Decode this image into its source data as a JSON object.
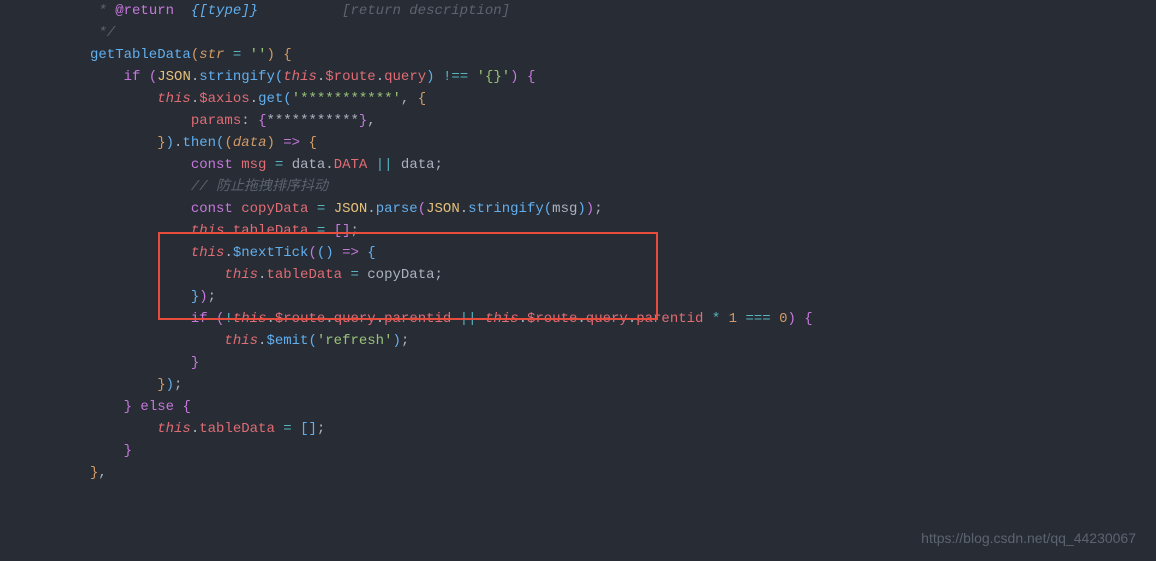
{
  "code": {
    "line1": {
      "prefix": " * ",
      "tag": "@return",
      "type": "  {[type]}",
      "desc": "          [return description]"
    },
    "line2": {
      "text": " */"
    },
    "line3": {
      "method": "getTableData",
      "paren1": "(",
      "param": "str",
      "eq": " = ",
      "str": "''",
      "paren2": ")",
      "brace": " {"
    },
    "line4": {
      "indent": "    ",
      "if": "if",
      "paren": " (",
      "global": "JSON",
      "dot1": ".",
      "method": "stringify",
      "paren2": "(",
      "this": "this",
      "dot2": ".",
      "prop1": "$route",
      "dot3": ".",
      "prop2": "query",
      "paren3": ")",
      "op": " !== ",
      "str": "'{}'",
      "paren4": ")",
      "brace": " {"
    },
    "line5": {
      "indent": "        ",
      "this": "this",
      "dot": ".",
      "prop": "$axios",
      "dot2": ".",
      "method": "get",
      "paren": "(",
      "str": "'***********'",
      "comma": ", ",
      "brace": "{"
    },
    "line6": {
      "indent": "            ",
      "prop": "params",
      "colon": ": ",
      "brace1": "{",
      "stars": "***********",
      "brace2": "}",
      "comma": ","
    },
    "line7": {
      "indent": "        ",
      "brace": "}",
      "paren": ")",
      "dot": ".",
      "method": "then",
      "paren2": "(",
      "paren3": "(",
      "param": "data",
      "paren4": ")",
      "arrow": " => ",
      "brace2": "{"
    },
    "line8": {
      "indent": "            ",
      "const": "const",
      "sp": " ",
      "var": "msg",
      "eq": " = ",
      "data": "data",
      "dot": ".",
      "prop": "DATA",
      "or": " || ",
      "data2": "data",
      "semi": ";"
    },
    "line9": {
      "indent": "            ",
      "comment": "// 防止拖拽排序抖动"
    },
    "line10": {
      "indent": "            ",
      "const": "const",
      "sp": " ",
      "var": "copyData",
      "eq": " = ",
      "global": "JSON",
      "dot": ".",
      "method": "parse",
      "paren": "(",
      "global2": "JSON",
      "dot2": ".",
      "method2": "stringify",
      "paren2": "(",
      "arg": "msg",
      "paren3": ")",
      "paren4": ")",
      "semi": ";"
    },
    "line11": {
      "indent": "            ",
      "this": "this",
      "dot": ".",
      "prop": "tableData",
      "eq": " = ",
      "bracket1": "[",
      "bracket2": "]",
      "semi": ";"
    },
    "line12": {
      "indent": "            ",
      "this": "this",
      "dot": ".",
      "method": "$nextTick",
      "paren": "(",
      "paren2": "(",
      "paren3": ")",
      "arrow": " => ",
      "brace": "{"
    },
    "line13": {
      "indent": "                ",
      "this": "this",
      "dot": ".",
      "prop": "tableData",
      "eq": " = ",
      "var": "copyData",
      "semi": ";"
    },
    "line14": {
      "indent": "            ",
      "brace": "}",
      "paren": ")",
      "semi": ";"
    },
    "line15": {
      "indent": "            ",
      "if": "if",
      "paren": " (",
      "not": "!",
      "this": "this",
      "dot": ".",
      "prop1": "$route",
      "dot2": ".",
      "prop2": "query",
      "dot3": ".",
      "prop3": "parentid",
      "or": " || ",
      "this2": "this",
      "dot4": ".",
      "prop4": "$route",
      "dot5": ".",
      "prop5": "query",
      "dot6": ".",
      "prop6": "parentid",
      "mul": " * ",
      "num1": "1",
      "eq": " === ",
      "num2": "0",
      "paren2": ")",
      "brace": " {"
    },
    "line16": {
      "indent": "                ",
      "this": "this",
      "dot": ".",
      "method": "$emit",
      "paren": "(",
      "str": "'refresh'",
      "paren2": ")",
      "semi": ";"
    },
    "line17": {
      "indent": "            ",
      "brace": "}"
    },
    "line18": {
      "indent": "        ",
      "brace": "}",
      "paren": ")",
      "semi": ";"
    },
    "line19": {
      "indent": "    ",
      "brace": "}",
      "else": " else ",
      "brace2": "{"
    },
    "line20": {
      "indent": "        ",
      "this": "this",
      "dot": ".",
      "prop": "tableData",
      "eq": " = ",
      "bracket1": "[",
      "bracket2": "]",
      "semi": ";"
    },
    "line21": {
      "indent": "    ",
      "brace": "}"
    },
    "line22": {
      "brace": "}",
      "comma": ","
    }
  },
  "watermark": "https://blog.csdn.net/qq_44230067"
}
